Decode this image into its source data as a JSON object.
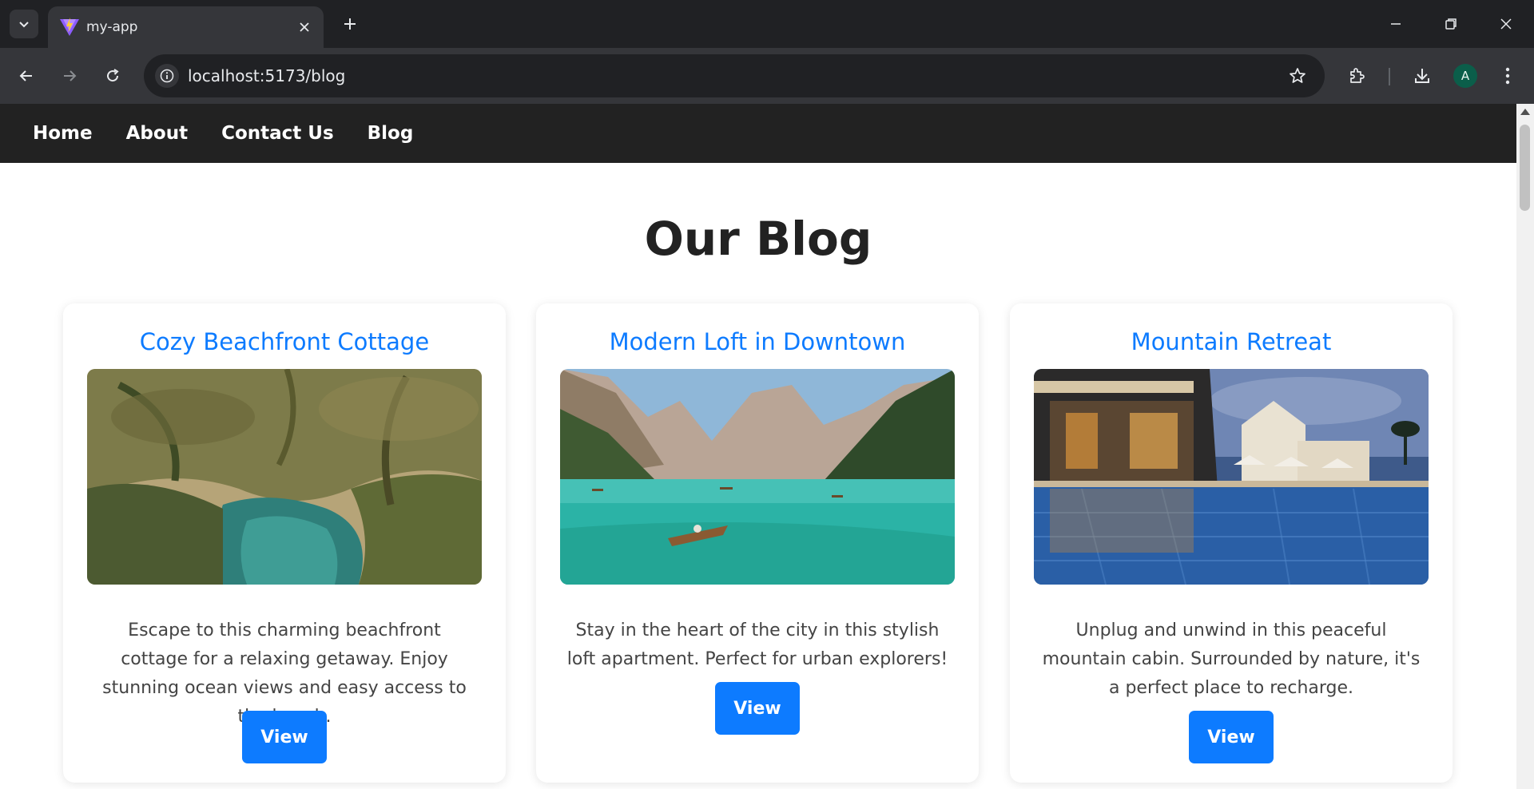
{
  "browser": {
    "tab_title": "my-app",
    "url": "localhost:5173/blog",
    "profile_initial": "A",
    "avatar_color": "#0b5e4a"
  },
  "nav": {
    "items": [
      "Home",
      "About",
      "Contact Us",
      "Blog"
    ]
  },
  "page": {
    "title": "Our Blog"
  },
  "posts": [
    {
      "title": "Cozy Beachfront Cottage",
      "image": "tropical-river-palms",
      "description": "Escape to this charming beachfront cottage for a relaxing getaway. Enjoy stunning ocean views and easy access to the beach.",
      "button": "View"
    },
    {
      "title": "Modern Loft in Downtown",
      "image": "mountain-lake-boat",
      "description": "Stay in the heart of the city in this stylish loft apartment. Perfect for urban explorers!",
      "button": "View"
    },
    {
      "title": "Mountain Retreat",
      "image": "resort-pool-dusk",
      "description": "Unplug and unwind in this peaceful mountain cabin. Surrounded by nature, it's a perfect place to recharge.",
      "button": "View"
    }
  ],
  "colors": {
    "accent": "#0d7bff",
    "nav_bg": "#222222",
    "heading": "#222222",
    "body_text": "#444444"
  }
}
